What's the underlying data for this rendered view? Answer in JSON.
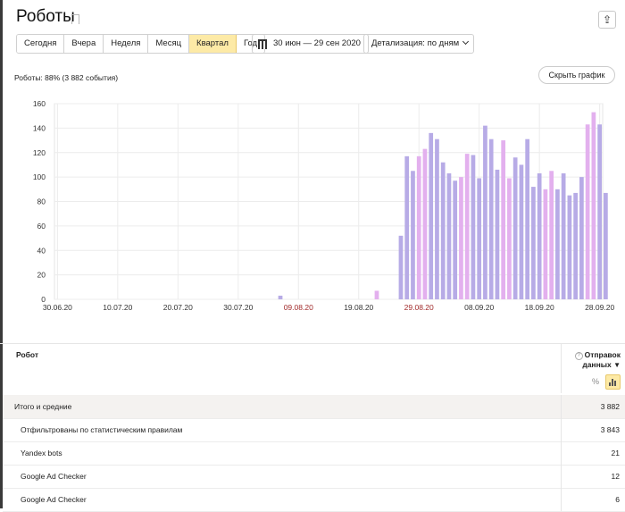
{
  "header": {
    "title": "Роботы",
    "periods": [
      "Сегодня",
      "Вчера",
      "Неделя",
      "Месяц",
      "Квартал",
      "Год"
    ],
    "active_period": "Квартал",
    "date_range": "30 июн — 29 сен 2020",
    "detail": "Детализация: по дням"
  },
  "summary_text": "Роботы: 88% (3 882 события)",
  "hide_chart_label": "Скрыть график",
  "chart_data": {
    "type": "bar",
    "x_labels": [
      "30.06.20",
      "10.07.20",
      "20.07.20",
      "30.07.20",
      "09.08.20",
      "19.08.20",
      "29.08.20",
      "08.09.20",
      "18.09.20",
      "28.09.20"
    ],
    "x_label_weekend": [
      false,
      false,
      false,
      false,
      true,
      false,
      true,
      false,
      false,
      false
    ],
    "y_ticks": [
      0,
      20,
      40,
      60,
      80,
      100,
      120,
      140,
      160
    ],
    "ylim": [
      0,
      160
    ],
    "grid": true,
    "first_date": "30.06.20",
    "colors": {
      "weekday": "#b7abe6",
      "weekend": "#e3b0ee"
    },
    "bars": [
      {
        "date": "06.08.20",
        "value": 3,
        "weekend": false
      },
      {
        "date": "22.08.20",
        "value": 7,
        "weekend": true
      },
      {
        "date": "26.08.20",
        "value": 52,
        "weekend": false
      },
      {
        "date": "27.08.20",
        "value": 117,
        "weekend": false
      },
      {
        "date": "28.08.20",
        "value": 105,
        "weekend": false
      },
      {
        "date": "29.08.20",
        "value": 117,
        "weekend": true
      },
      {
        "date": "30.08.20",
        "value": 123,
        "weekend": true
      },
      {
        "date": "31.08.20",
        "value": 136,
        "weekend": false
      },
      {
        "date": "01.09.20",
        "value": 131,
        "weekend": false
      },
      {
        "date": "02.09.20",
        "value": 112,
        "weekend": false
      },
      {
        "date": "03.09.20",
        "value": 103,
        "weekend": false
      },
      {
        "date": "04.09.20",
        "value": 97,
        "weekend": false
      },
      {
        "date": "05.09.20",
        "value": 100,
        "weekend": true
      },
      {
        "date": "06.09.20",
        "value": 119,
        "weekend": true
      },
      {
        "date": "07.09.20",
        "value": 118,
        "weekend": false
      },
      {
        "date": "08.09.20",
        "value": 99,
        "weekend": false
      },
      {
        "date": "09.09.20",
        "value": 142,
        "weekend": false
      },
      {
        "date": "10.09.20",
        "value": 131,
        "weekend": false
      },
      {
        "date": "11.09.20",
        "value": 106,
        "weekend": false
      },
      {
        "date": "12.09.20",
        "value": 130,
        "weekend": true
      },
      {
        "date": "13.09.20",
        "value": 99,
        "weekend": true
      },
      {
        "date": "14.09.20",
        "value": 116,
        "weekend": false
      },
      {
        "date": "15.09.20",
        "value": 110,
        "weekend": false
      },
      {
        "date": "16.09.20",
        "value": 131,
        "weekend": false
      },
      {
        "date": "17.09.20",
        "value": 92,
        "weekend": false
      },
      {
        "date": "18.09.20",
        "value": 103,
        "weekend": false
      },
      {
        "date": "19.09.20",
        "value": 90,
        "weekend": true
      },
      {
        "date": "20.09.20",
        "value": 105,
        "weekend": true
      },
      {
        "date": "21.09.20",
        "value": 90,
        "weekend": false
      },
      {
        "date": "22.09.20",
        "value": 103,
        "weekend": false
      },
      {
        "date": "23.09.20",
        "value": 85,
        "weekend": false
      },
      {
        "date": "24.09.20",
        "value": 87,
        "weekend": false
      },
      {
        "date": "25.09.20",
        "value": 100,
        "weekend": false
      },
      {
        "date": "26.09.20",
        "value": 143,
        "weekend": true
      },
      {
        "date": "27.09.20",
        "value": 153,
        "weekend": true
      },
      {
        "date": "28.09.20",
        "value": 143,
        "weekend": false
      },
      {
        "date": "29.09.20",
        "value": 87,
        "weekend": false
      }
    ]
  },
  "table": {
    "col_robot": "Робот",
    "col_metric": "Отправок данных",
    "sort_icon": "sort-desc-icon",
    "pct_label": "%",
    "rows": [
      {
        "name": "Итого и средние",
        "value": "3 882",
        "total": true,
        "indent": false
      },
      {
        "name": "Отфильтрованы по статистическим правилам",
        "value": "3 843",
        "total": false,
        "indent": true
      },
      {
        "name": "Yandex bots",
        "value": "21",
        "total": false,
        "indent": true
      },
      {
        "name": "Google Ad Checker",
        "value": "12",
        "total": false,
        "indent": true
      },
      {
        "name": "Google Ad Checker",
        "value": "6",
        "total": false,
        "indent": true
      }
    ]
  }
}
